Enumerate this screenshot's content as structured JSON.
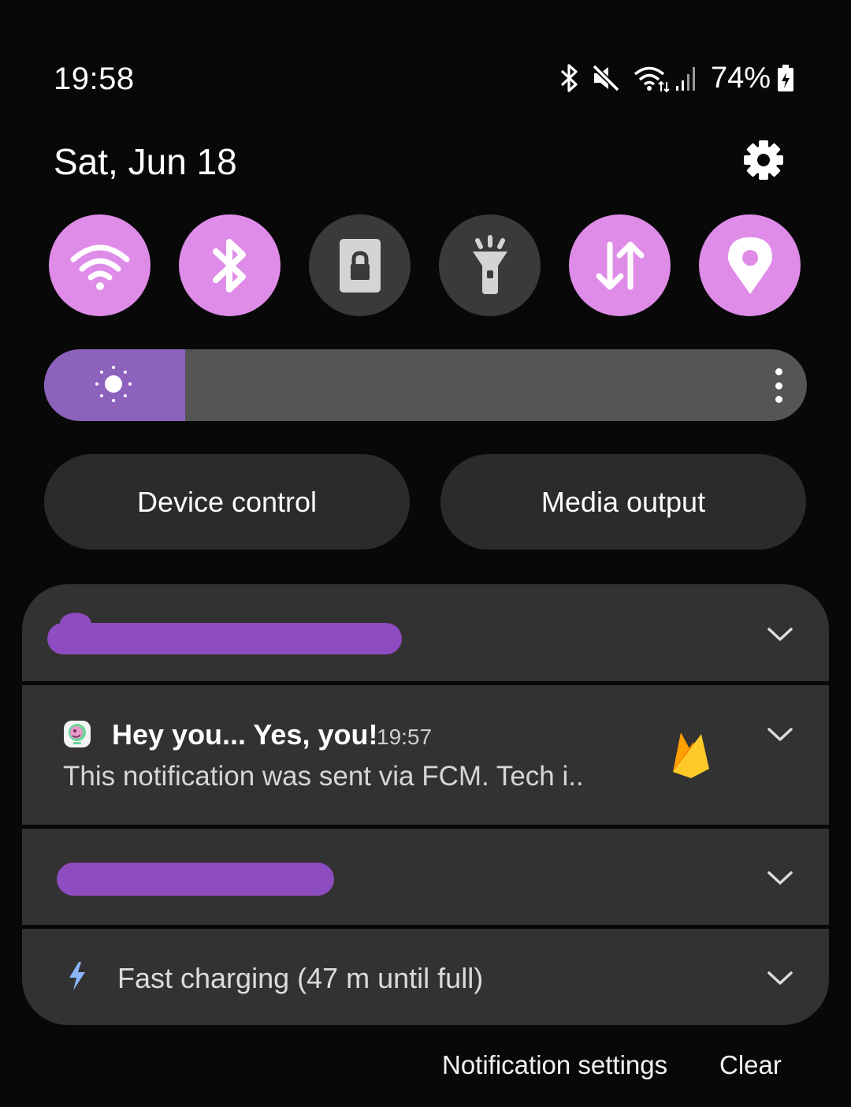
{
  "status_bar": {
    "time": "19:58",
    "battery": "74%",
    "icons": [
      "bluetooth-icon",
      "mute-icon",
      "wifi-data-icon",
      "signal-icon",
      "battery-charging-icon"
    ]
  },
  "header": {
    "date": "Sat, Jun 18",
    "settings_icon": "gear-icon"
  },
  "quick_toggles": [
    {
      "name": "Wi-Fi",
      "icon": "wifi-icon",
      "state": "on"
    },
    {
      "name": "Bluetooth",
      "icon": "bluetooth-icon",
      "state": "on"
    },
    {
      "name": "Screen lock",
      "icon": "lock-icon",
      "state": "off"
    },
    {
      "name": "Flashlight",
      "icon": "flashlight-icon",
      "state": "off"
    },
    {
      "name": "Mobile data",
      "icon": "data-arrows-icon",
      "state": "on"
    },
    {
      "name": "Location",
      "icon": "location-pin-icon",
      "state": "on"
    }
  ],
  "brightness": {
    "level": 0.185,
    "icon": "sun-icon"
  },
  "buttons": {
    "device_control": "Device control",
    "media_output": "Media output"
  },
  "notifications": {
    "fcm": {
      "title": "Hey you... Yes, you!",
      "time": "19:57",
      "body": "This notification was sent via FCM. Tech i.."
    },
    "charging": {
      "text": "Fast charging (47 m until full)"
    }
  },
  "footer": {
    "notification_settings": "Notification settings",
    "clear": "Clear"
  },
  "colors": {
    "toggle_on": "#df8ce8",
    "toggle_off": "#3a3a3a",
    "brightness_fill": "#8d62bd",
    "redaction": "#8d4cbf",
    "card_bg": "#323232"
  }
}
